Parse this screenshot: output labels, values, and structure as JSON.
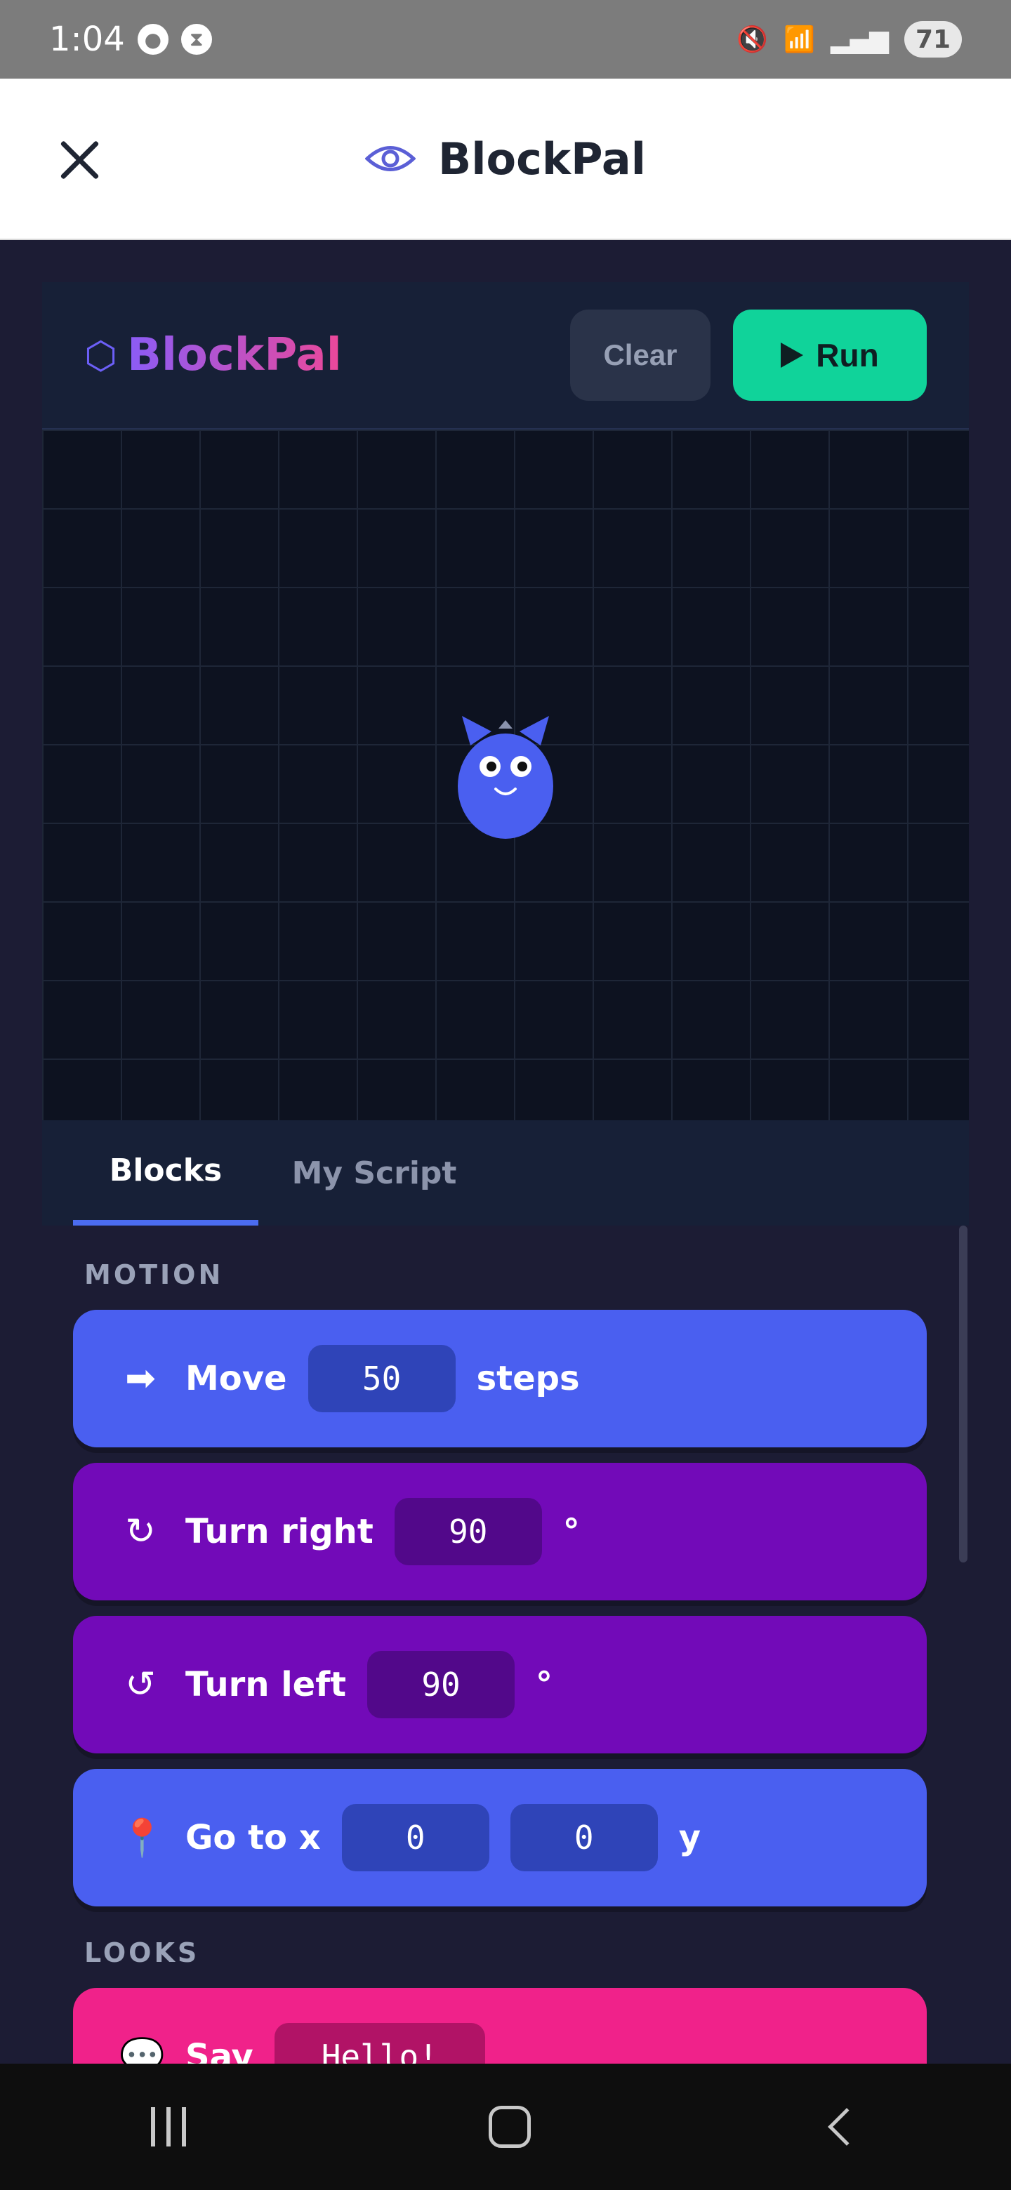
{
  "status_bar": {
    "time": "1:04",
    "battery": "71",
    "icons": [
      "account-icon",
      "sync-icon",
      "mute-icon",
      "wifi-icon",
      "signal-icon"
    ]
  },
  "header": {
    "title": "BlockPal",
    "icon": "eye-icon"
  },
  "game": {
    "logo": "BlockPal",
    "clear_label": "Clear",
    "run_label": "Run",
    "colors": {
      "run": "#10d39a",
      "clear": "#2a3349",
      "stage": "#0d1220",
      "sprite": "#4a5ff0"
    }
  },
  "tabs": [
    {
      "label": "Blocks",
      "active": true
    },
    {
      "label": "My Script",
      "active": false
    }
  ],
  "palette": {
    "categories": [
      {
        "label": "MOTION",
        "blocks": [
          {
            "icon": "➡",
            "text": "Move",
            "value": "50",
            "suffix": "steps",
            "color": "#4a5ff0"
          },
          {
            "icon": "↻",
            "text": "Turn right",
            "value": "90",
            "suffix": "°",
            "color": "#720ab8"
          },
          {
            "icon": "↺",
            "text": "Turn left",
            "value": "90",
            "suffix": "°",
            "color": "#720ab8"
          },
          {
            "icon": "📍",
            "text": "Go to x",
            "value": "0",
            "value2": "0",
            "suffix": "y",
            "color": "#4a5ff0"
          }
        ]
      },
      {
        "label": "LOOKS",
        "blocks": [
          {
            "icon": "💬",
            "text": "Say",
            "value": "Hello!",
            "color": "#f0228a"
          }
        ]
      }
    ]
  }
}
